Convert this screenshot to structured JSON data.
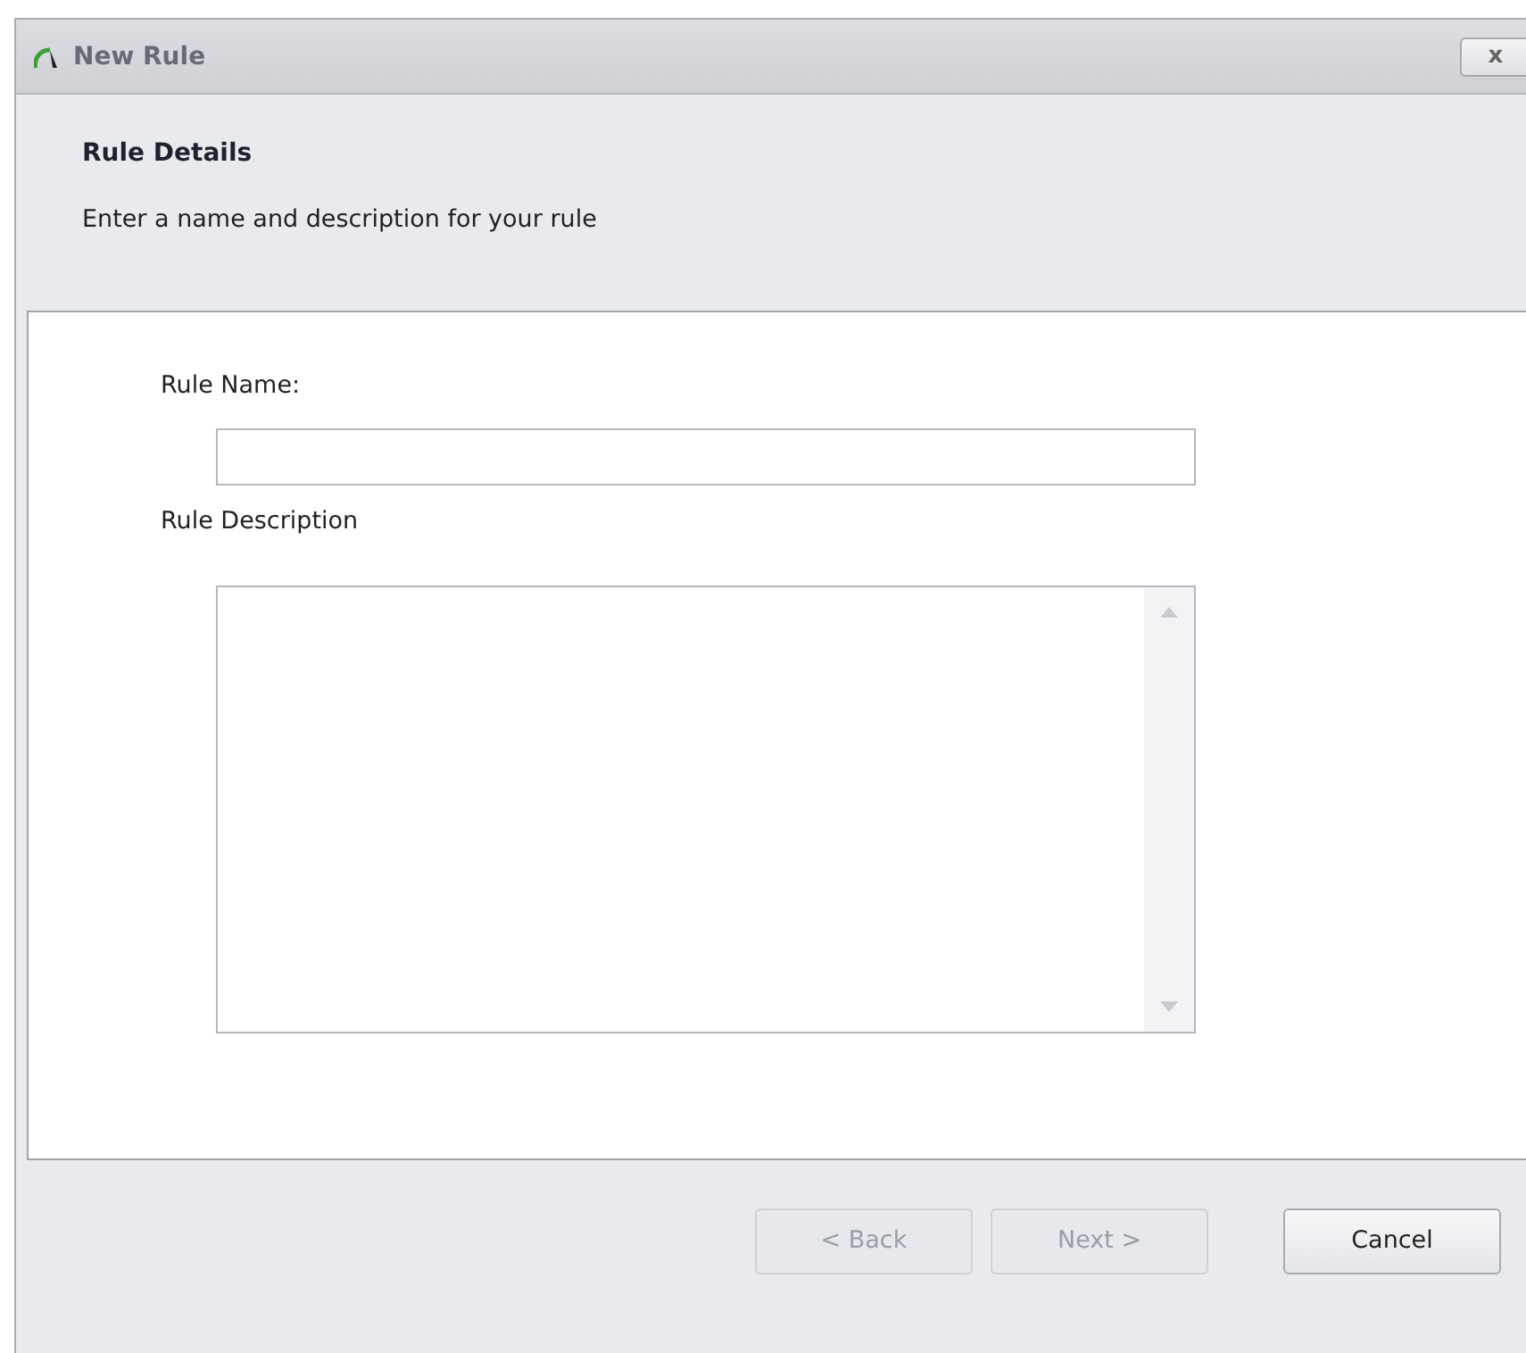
{
  "window": {
    "title": "New Rule",
    "close": "x"
  },
  "header": {
    "title": "Rule Details",
    "subtitle": "Enter a name and description for your rule"
  },
  "form": {
    "name_label": "Rule Name:",
    "description_label": "Rule Description"
  },
  "buttons": [
    {
      "label": "< Back",
      "disabled": true
    },
    {
      "label": "Next >",
      "disabled": true
    },
    {
      "label": "Cancel",
      "disabled": false
    }
  ]
}
